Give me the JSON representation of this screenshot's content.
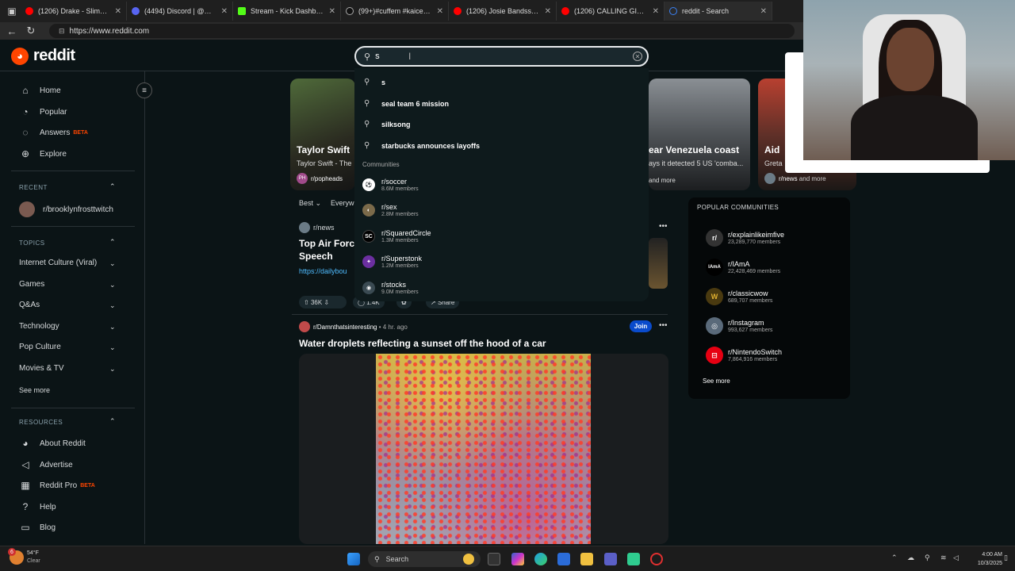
{
  "browser": {
    "tabs": [
      {
        "label": "(1206) Drake - Slime You O",
        "color": "#ff0000"
      },
      {
        "label": "(4494) Discord | @Rich",
        "color": "#5865f2"
      },
      {
        "label": "Stream - Kick Dashboard",
        "color": "#53fc18"
      },
      {
        "label": "(99+)#cuffem #kaicenat #a",
        "color": "#111111"
      },
      {
        "label": "(1206) Josie Bandss - YouTu",
        "color": "#ff0000"
      },
      {
        "label": "(1206) CALLING GIO ANOT",
        "color": "#ff0000"
      },
      {
        "label": "reddit - Search",
        "color": "#3b82f6"
      }
    ],
    "url": "https://www.reddit.com"
  },
  "header": {
    "logo_text": "reddit",
    "search_query": "s"
  },
  "sidebar": {
    "nav": [
      {
        "label": "Home",
        "icon": "home-icon"
      },
      {
        "label": "Popular",
        "icon": "popular-icon"
      },
      {
        "label": "Answers",
        "beta": "BETA",
        "icon": "answers-icon"
      },
      {
        "label": "Explore",
        "icon": "explore-icon"
      }
    ],
    "recent_heading": "RECENT",
    "recent_item": "r/brooklynfrosttwitch",
    "topics_heading": "TOPICS",
    "topics": [
      "Internet Culture (Viral)",
      "Games",
      "Q&As",
      "Technology",
      "Pop Culture",
      "Movies & TV"
    ],
    "see_more": "See more",
    "resources_heading": "RESOURCES",
    "resources": [
      {
        "label": "About Reddit",
        "icon": "reddit-icon"
      },
      {
        "label": "Advertise",
        "icon": "megaphone-icon"
      },
      {
        "label": "Reddit Pro",
        "beta": "BETA",
        "icon": "chart-icon"
      },
      {
        "label": "Help",
        "icon": "help-icon"
      },
      {
        "label": "Blog",
        "icon": "book-icon"
      }
    ]
  },
  "carousel": {
    "card1": {
      "title": "Taylor Swift",
      "sub": "Taylor Swift - The",
      "community": "r/popheads",
      "badge": "PH"
    },
    "card2": {
      "title": "ear Venezuela coast",
      "sub": "ays it detected 5 US 'comba...",
      "more": "and more"
    },
    "card3": {
      "title": "Aid",
      "sub": "Greta",
      "community": "r/news",
      "more": "and more"
    }
  },
  "dropdown": {
    "suggestions": [
      "s",
      "seal team 6 mission",
      "silksong",
      "starbucks announces layoffs"
    ],
    "communities_heading": "Communities",
    "communities": [
      {
        "name": "r/soccer",
        "members": "8.6M members",
        "color": "#ffffff",
        "glyph": "⚽"
      },
      {
        "name": "r/sex",
        "members": "2.8M members",
        "color": "#7b6a4a",
        "glyph": "◐"
      },
      {
        "name": "r/SquaredCircle",
        "members": "1.3M members",
        "color": "#000000",
        "glyph": "SC"
      },
      {
        "name": "r/Superstonk",
        "members": "1.2M members",
        "color": "#6b2fa0",
        "glyph": "✦"
      },
      {
        "name": "r/stocks",
        "members": "9.0M members",
        "color": "#3a4a52",
        "glyph": "◉"
      }
    ]
  },
  "feed": {
    "sort": "Best",
    "view": "Everywh",
    "post1": {
      "community": "r/news",
      "title_line1": "Top Air Force",
      "title_line2": "Speech",
      "link": "https://dailybou",
      "votes": "36K",
      "comments": "1.4K",
      "share": "Share"
    },
    "post2": {
      "community": "r/Damnthatsinteresting",
      "time": "• 4 hr. ago",
      "join": "Join",
      "title": "Water droplets reflecting a sunset off the hood of a car"
    }
  },
  "popular": {
    "heading": "POPULAR COMMUNITIES",
    "items": [
      {
        "name": "r/explainlikeimfive",
        "members": "23,289,770 members",
        "color": "#333333",
        "glyph": "r/"
      },
      {
        "name": "r/IAmA",
        "members": "22,428,469 members",
        "color": "#000000",
        "glyph": "IAmA"
      },
      {
        "name": "r/classicwow",
        "members": "689,707 members",
        "color": "#4a3a10",
        "glyph": "W"
      },
      {
        "name": "r/Instagram",
        "members": "993,627 members",
        "color": "#5a6a7a",
        "glyph": "◎"
      },
      {
        "name": "r/NintendoSwitch",
        "members": "7,864,916 members",
        "color": "#e60012",
        "glyph": "⊟"
      }
    ],
    "see_more": "See more"
  },
  "taskbar": {
    "weather_temp": "54°F",
    "weather_desc": "Clear",
    "weather_badge": "6",
    "search_label": "Search",
    "time": "4:00 AM",
    "date": "10/3/2025"
  }
}
